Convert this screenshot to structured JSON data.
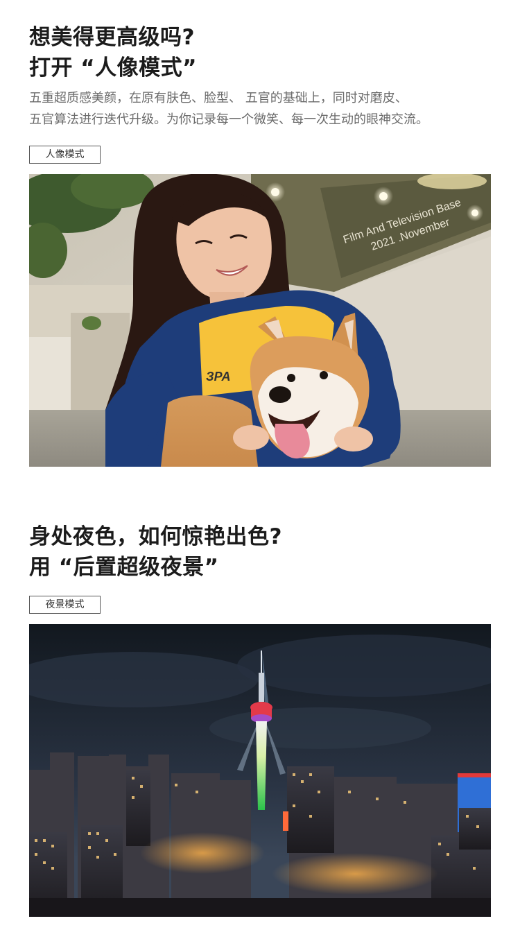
{
  "portrait_section": {
    "headline_line1": "想美得更高级吗?",
    "headline_line2": "打开 “人像模式”",
    "desc_line1": "五重超质感美颜，在原有肤色、脸型、 五官的基础上，同时对磨皮、",
    "desc_line2": "五官算法进行迭代升级。为你记录每一个微笑、每一次生动的眼神交流。",
    "tag": "人像模式",
    "photo_wall_text_1": "Film And Television Base",
    "photo_wall_text_2": "2021 .November",
    "shirt_logo": "ЗРА"
  },
  "night_section": {
    "headline_line1": "身处夜色，如何惊艳出色?",
    "headline_line2": "用 “后置超级夜景”",
    "tag": "夜景模式"
  },
  "colors": {
    "headline": "#1b1b1b",
    "description": "#6b6b6b",
    "tag_border": "#555555",
    "night_sky": "#1a2233",
    "tower_light": "#e33a4a"
  }
}
